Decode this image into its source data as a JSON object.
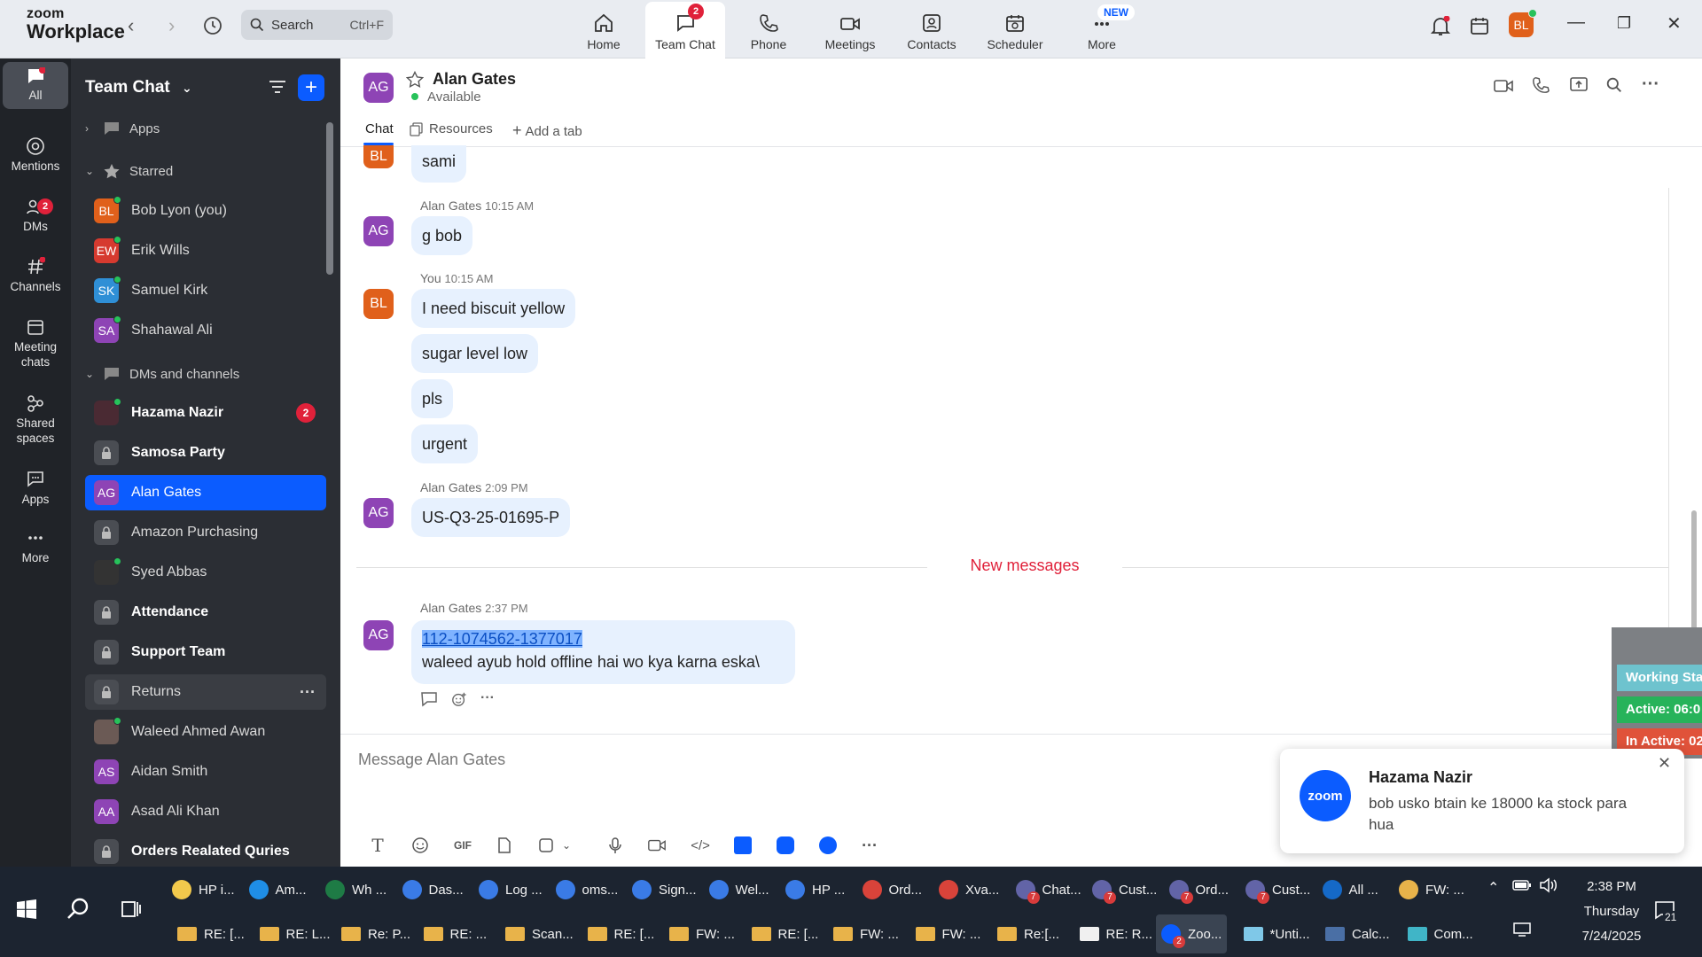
{
  "app": {
    "logo_line1": "zoom",
    "logo_line2": "Workplace"
  },
  "search": {
    "placeholder": "Search",
    "shortcut": "Ctrl+F"
  },
  "nav_tabs": [
    {
      "label": "Home"
    },
    {
      "label": "Team Chat",
      "badge": "2"
    },
    {
      "label": "Phone"
    },
    {
      "label": "Meetings"
    },
    {
      "label": "Contacts"
    },
    {
      "label": "Scheduler"
    },
    {
      "label": "More",
      "badge_text": "NEW"
    }
  ],
  "profile": {
    "initials": "BL",
    "color": "#e0601b"
  },
  "rail": [
    {
      "label": "All"
    },
    {
      "label": "Mentions"
    },
    {
      "label": "DMs",
      "badge": "2"
    },
    {
      "label": "Channels"
    },
    {
      "label_line1": "Meeting",
      "label_line2": "chats"
    },
    {
      "label_line1": "Shared",
      "label_line2": "spaces"
    },
    {
      "label": "Apps"
    },
    {
      "label": "More"
    }
  ],
  "sidebar": {
    "title": "Team Chat",
    "sections": {
      "apps": "Apps",
      "starred": "Starred",
      "dms": "DMs and channels"
    },
    "starred": [
      {
        "initials": "BL",
        "name": "Bob Lyon (you)",
        "color": "#e0601b"
      },
      {
        "initials": "EW",
        "name": "Erik Wills",
        "color": "#d63a2f"
      },
      {
        "initials": "SK",
        "name": "Samuel Kirk",
        "color": "#2f8fd6"
      },
      {
        "initials": "SA",
        "name": "Shahawal Ali",
        "color": "#8e44b5"
      }
    ],
    "channels": [
      {
        "name": "Hazama Nazir",
        "badge": "2"
      },
      {
        "name": "Samosa Party"
      },
      {
        "initials": "AG",
        "name": "Alan Gates"
      },
      {
        "name": "Amazon Purchasing"
      },
      {
        "name": "Syed Abbas"
      },
      {
        "name": "Attendance"
      },
      {
        "name": "Support Team"
      },
      {
        "name": "Returns",
        "more": "···"
      },
      {
        "name": "Waleed Ahmed Awan"
      },
      {
        "initials": "AS",
        "name": "Aidan Smith"
      },
      {
        "initials": "AA",
        "name": "Asad Ali Khan"
      },
      {
        "name": "Orders Realated Quries"
      }
    ]
  },
  "chat": {
    "contact_initials": "AG",
    "contact_name": "Alan Gates",
    "status": "Available",
    "tabs": {
      "chat": "Chat",
      "resources": "Resources",
      "add": "Add a tab"
    },
    "messages": [
      {
        "initials": "BL",
        "text": "sami"
      },
      {
        "sender": "Alan Gates",
        "time": "10:15 AM",
        "initials": "AG",
        "text": "g bob"
      },
      {
        "sender": "You",
        "time": "10:15 AM",
        "initials": "BL",
        "texts": [
          "I need biscuit yellow",
          "sugar level low",
          "pls",
          "urgent"
        ]
      },
      {
        "sender": "Alan Gates",
        "time": "2:09 PM",
        "initials": "AG",
        "text": "US-Q3-25-01695-P"
      },
      {
        "sender": "Alan Gates",
        "time": "2:37 PM",
        "initials": "AG",
        "link_a": "112-1074562",
        "link_sep": "-",
        "link_b": "1377017",
        "text": "waleed ayub hold offline hai wo kya karna eska\\"
      }
    ],
    "new_messages_label": "New messages",
    "input_placeholder": "Message Alan Gates",
    "toolbar_gif": "GIF"
  },
  "toast": {
    "logo": "zoom",
    "name": "Hazama Nazir",
    "message": "bob usko btain ke 18000 ka stock para hua"
  },
  "working_status": {
    "title": "Working Sta",
    "active": "Active: 06:0",
    "inactive": "In Active: 02"
  },
  "taskbar": {
    "row1": [
      "HP i...",
      "Am...",
      "Wh ...",
      "Das...",
      "Log ...",
      "oms...",
      "Sign...",
      "Wel...",
      "HP ...",
      "Ord...",
      "Xva...",
      "Chat...",
      "Cust...",
      "Ord...",
      "Cust...",
      "All ...",
      "FW: ..."
    ],
    "row2": [
      "RE: [...",
      "RE: L...",
      "Re: P...",
      "RE: ...",
      "Scan...",
      "RE: [...",
      "FW: ...",
      "RE: [...",
      "FW: ...",
      "FW: ...",
      "Re:[...",
      "RE: R...",
      "Zoo...",
      "*Unti...",
      "Calc...",
      "Com..."
    ],
    "time": "2:38 PM",
    "day": "Thursday",
    "date": "7/24/2025",
    "notifications": "21"
  }
}
